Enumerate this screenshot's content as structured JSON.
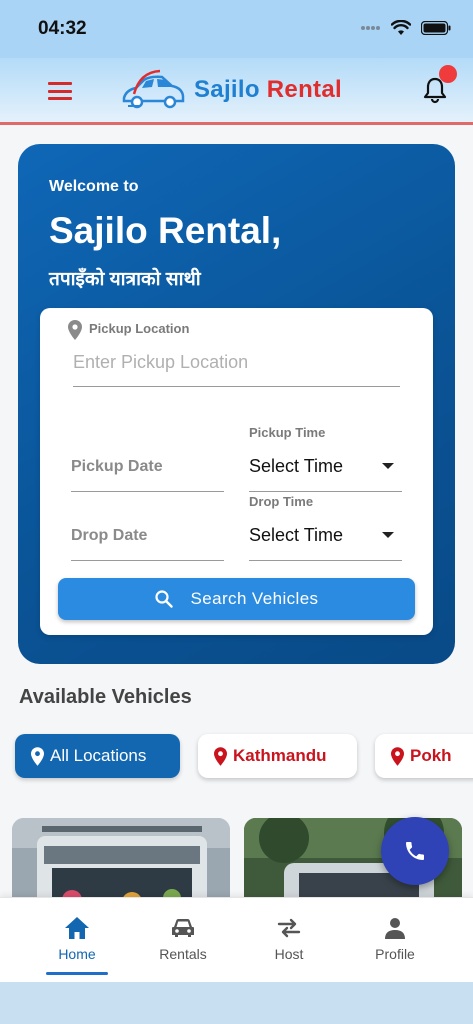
{
  "status_bar": {
    "time": "04:32"
  },
  "header": {
    "logo_part1": "Sajilo",
    "logo_part2": "Rental"
  },
  "hero": {
    "welcome": "Welcome to",
    "title": "Sajilo Rental,",
    "subtitle": "तपाइँको यात्राको साथी"
  },
  "form": {
    "pickup_location_label": "Pickup Location",
    "pickup_location_placeholder": "Enter Pickup Location",
    "pickup_date_placeholder": "Pickup Date",
    "pickup_time_label": "Pickup Time",
    "pickup_time_value": "Select Time",
    "drop_time_label": "Drop Time",
    "drop_date_placeholder": "Drop Date",
    "drop_time_value": "Select Time",
    "search_button": "Search Vehicles"
  },
  "vehicles": {
    "section_title": "Available Vehicles",
    "chips": [
      "All Locations",
      "Kathmandu",
      "Pokh"
    ]
  },
  "bottom_nav": {
    "items": [
      {
        "label": "Home",
        "icon": "home-icon"
      },
      {
        "label": "Rentals",
        "icon": "car-icon"
      },
      {
        "label": "Host",
        "icon": "swap-icon"
      },
      {
        "label": "Profile",
        "icon": "person-icon"
      }
    ]
  },
  "colors": {
    "primary": "#1267b0",
    "accent_red": "#c9141d",
    "button": "#2a8be0",
    "fab": "#2f43b6"
  }
}
